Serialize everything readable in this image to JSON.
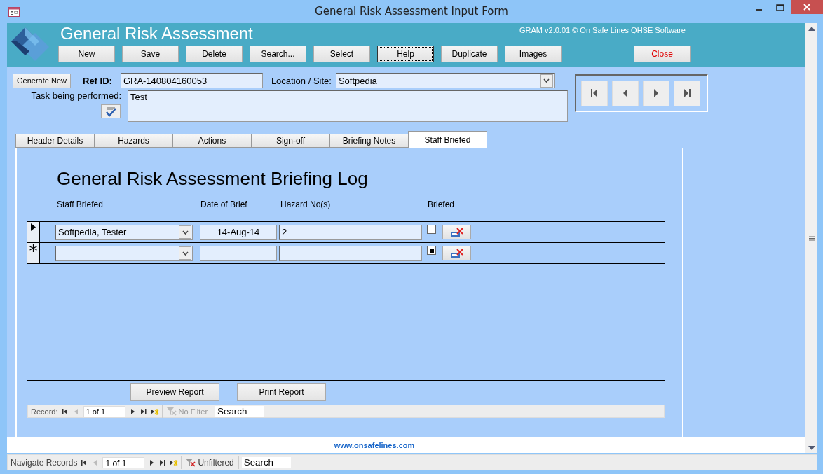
{
  "window": {
    "title": "General Risk Assessment Input Form"
  },
  "header": {
    "title": "General Risk Assessment",
    "version": "GRAM v2.0.01 © On Safe Lines QHSE Software",
    "buttons": [
      {
        "label": "New",
        "kind": "normal",
        "focused": false
      },
      {
        "label": "Save",
        "kind": "normal",
        "focused": false
      },
      {
        "label": "Delete",
        "kind": "normal",
        "focused": false
      },
      {
        "label": "Search...",
        "kind": "normal",
        "focused": false
      },
      {
        "label": "Select",
        "kind": "normal",
        "focused": false
      },
      {
        "label": "Help",
        "kind": "normal",
        "focused": true
      },
      {
        "label": "Duplicate",
        "kind": "normal",
        "focused": false
      },
      {
        "label": "Images",
        "kind": "normal",
        "focused": false
      },
      {
        "label": "Close",
        "kind": "close",
        "focused": false
      }
    ]
  },
  "record": {
    "generate_button": "Generate New",
    "ref_label": "Ref ID:",
    "ref_id": "GRA-140804160053",
    "location_label": "Location / Site:",
    "location": "Softpedia",
    "task_label": "Task being performed:",
    "task": "Test"
  },
  "nav_buttons": [
    {
      "kind": "first"
    },
    {
      "kind": "prev"
    },
    {
      "kind": "next"
    },
    {
      "kind": "last"
    }
  ],
  "tabs": [
    {
      "label": "Header Details",
      "selected": false
    },
    {
      "label": "Hazards",
      "selected": false
    },
    {
      "label": "Actions",
      "selected": false
    },
    {
      "label": "Sign-off",
      "selected": false
    },
    {
      "label": "Briefing Notes",
      "selected": false
    },
    {
      "label": "Staff Briefed",
      "selected": true
    }
  ],
  "briefing": {
    "title": "General Risk Assessment Briefing Log",
    "columns": [
      "Staff Briefed",
      "Date of Brief",
      "Hazard No(s)",
      "Briefed"
    ],
    "rows": [
      {
        "kind": "current",
        "staff": "Softpedia, Tester",
        "date": "14-Aug-14",
        "hazards": "2",
        "checked": false,
        "indeterminate": false
      },
      {
        "kind": "new",
        "indeterminate": true
      }
    ],
    "report_buttons": [
      "Preview Report",
      "Print Report"
    ],
    "navigator": {
      "label": "Record:",
      "position": "1 of 1",
      "filter": "No Filter",
      "filter_disabled": true,
      "placeholder": "Search"
    }
  },
  "footer": {
    "link": "www.onsafelines.com"
  },
  "status_nav": {
    "label": "Navigate Records",
    "position": "1 of 1",
    "filter": "Unfiltered",
    "filter_disabled": false,
    "placeholder": "Search"
  }
}
